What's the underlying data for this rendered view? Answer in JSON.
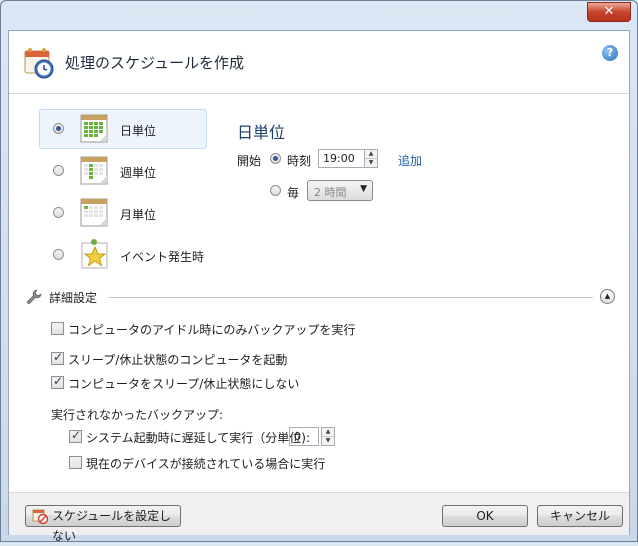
{
  "window": {
    "close_label": "✕"
  },
  "header": {
    "title": "処理のスケジュールを作成",
    "help_label": "?"
  },
  "periods": [
    {
      "label": "日単位",
      "selected": true
    },
    {
      "label": "週単位",
      "selected": false
    },
    {
      "label": "月単位",
      "selected": false
    },
    {
      "label": "イベント発生時",
      "selected": false
    }
  ],
  "schedule": {
    "title": "日単位",
    "start_label": "開始",
    "time_option": "時刻",
    "time_value": "19:00",
    "add_link": "追加",
    "every_option": "毎",
    "interval_value": "2 時間"
  },
  "advanced": {
    "section_label": "詳細設定",
    "idle_only": {
      "label": "コンピュータのアイドル時にのみバックアップを実行",
      "checked": false
    },
    "wake": {
      "label": "スリープ/休止状態のコンピュータを起動",
      "checked": true
    },
    "prevent_sleep": {
      "label": "コンピュータをスリープ/休止状態にしない",
      "checked": true
    },
    "missed_heading": "実行されなかったバックアップ:",
    "delay_on_startup": {
      "label": "システム起動時に遅延して実行（分単位):",
      "checked": true,
      "value": "0"
    },
    "device_connected": {
      "label": "現在のデバイスが接続されている場合に実行",
      "checked": false
    }
  },
  "footer": {
    "no_schedule_label": "スケジュールを設定しない",
    "ok_label": "OK",
    "cancel_label": "キャンセル"
  }
}
